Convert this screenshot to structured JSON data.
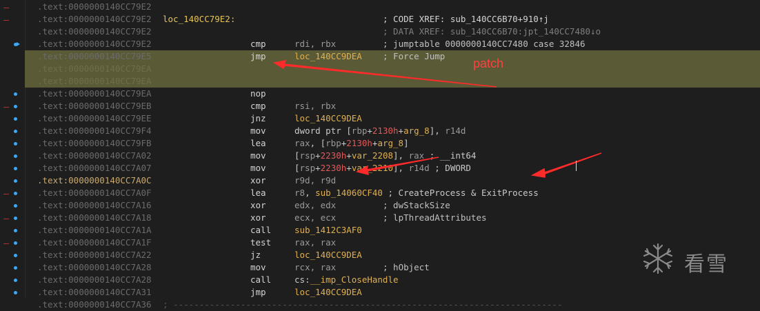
{
  "colors": {
    "background": "#1e1e1e",
    "highlight": "#5a5a36",
    "address": "#6b6b6b",
    "label": "#e4c45a",
    "annotation": "#ff4040"
  },
  "annotation_label": "patch",
  "watermark": "看雪",
  "lines": [
    {
      "addr": ".text:0000000140CC79E2"
    },
    {
      "addr": ".text:0000000140CC79E2",
      "label": "loc_140CC79E2:",
      "comment": "; CODE XREF: sub_140CC6B70+910↑j"
    },
    {
      "addr": ".text:0000000140CC79E2",
      "comment": "; DATA XREF: sub_140CC6B70:jpt_140CC7480↓o"
    },
    {
      "addr": ".text:0000000140CC79E2",
      "mn": "cmp",
      "ops": [
        [
          "reg",
          "rdi, rbx"
        ]
      ],
      "comment": "; jumptable 0000000140CC7480 case 32846"
    },
    {
      "addr": ".text:0000000140CC79E5",
      "mn": "jmp",
      "ops": [
        [
          "nm",
          "loc_140CC9DEA"
        ]
      ],
      "comment": "; Force Jump"
    },
    {
      "addr": ".text:0000000140CC79EA"
    },
    {
      "addr": ".text:0000000140CC79EA"
    },
    {
      "addr": ".text:0000000140CC79EA",
      "mn": "nop"
    },
    {
      "addr": ".text:0000000140CC79EB",
      "mn": "cmp",
      "ops": [
        [
          "reg",
          "rsi, rbx"
        ]
      ]
    },
    {
      "addr": ".text:0000000140CC79EE",
      "mn": "jnz",
      "ops": [
        [
          "nm",
          "loc_140CC9DEA"
        ]
      ]
    },
    {
      "addr": ".text:0000000140CC79F4",
      "mn": "mov",
      "ops": [
        [
          "tx",
          "dword ptr ["
        ],
        [
          "reg",
          "rbp"
        ],
        [
          "tx",
          "+"
        ],
        [
          "num",
          "2130h"
        ],
        [
          "tx",
          "+"
        ],
        [
          "nm",
          "arg_8"
        ],
        [
          "tx",
          "], "
        ],
        [
          "reg",
          "r14d"
        ]
      ]
    },
    {
      "addr": ".text:0000000140CC79FB",
      "mn": "lea",
      "ops": [
        [
          "reg",
          "rax"
        ],
        [
          "tx",
          ", ["
        ],
        [
          "reg",
          "rbp"
        ],
        [
          "tx",
          "+"
        ],
        [
          "num",
          "2130h"
        ],
        [
          "tx",
          "+"
        ],
        [
          "nm",
          "arg_8"
        ],
        [
          "tx",
          "]"
        ]
      ]
    },
    {
      "addr": ".text:0000000140CC7A02",
      "mn": "mov",
      "ops": [
        [
          "tx",
          "["
        ],
        [
          "reg",
          "rsp"
        ],
        [
          "tx",
          "+"
        ],
        [
          "num",
          "2230h"
        ],
        [
          "tx",
          "+"
        ],
        [
          "nm",
          "var_2208"
        ],
        [
          "tx",
          "], "
        ],
        [
          "reg",
          "rax"
        ],
        [
          "tx",
          " ; __int64"
        ]
      ]
    },
    {
      "addr": ".text:0000000140CC7A07",
      "mn": "mov",
      "ops": [
        [
          "tx",
          "["
        ],
        [
          "reg",
          "rsp"
        ],
        [
          "tx",
          "+"
        ],
        [
          "num",
          "2230h"
        ],
        [
          "tx",
          "+"
        ],
        [
          "nm",
          "var_2210"
        ],
        [
          "tx",
          "], "
        ],
        [
          "reg",
          "r14d"
        ],
        [
          "tx",
          " ; DWORD"
        ]
      ]
    },
    {
      "addr": ".text:0000000140CC7A0C",
      "mn": "xor",
      "ops": [
        [
          "reg",
          "r9d, r9d"
        ]
      ],
      "current": true
    },
    {
      "addr": ".text:0000000140CC7A0F",
      "mn": "lea",
      "ops": [
        [
          "reg",
          "r8"
        ],
        [
          "tx",
          ", "
        ],
        [
          "nm",
          "sub_14060CF40"
        ],
        [
          "tx",
          " ; CreateProcess & ExitProcess"
        ]
      ]
    },
    {
      "addr": ".text:0000000140CC7A16",
      "mn": "xor",
      "ops": [
        [
          "reg",
          "edx, edx"
        ]
      ],
      "comment": "; dwStackSize"
    },
    {
      "addr": ".text:0000000140CC7A18",
      "mn": "xor",
      "ops": [
        [
          "reg",
          "ecx, ecx"
        ]
      ],
      "comment": "; lpThreadAttributes"
    },
    {
      "addr": ".text:0000000140CC7A1A",
      "mn": "call",
      "ops": [
        [
          "nm",
          "sub_1412C3AF0"
        ]
      ]
    },
    {
      "addr": ".text:0000000140CC7A1F",
      "mn": "test",
      "ops": [
        [
          "reg",
          "rax, rax"
        ]
      ]
    },
    {
      "addr": ".text:0000000140CC7A22",
      "mn": "jz",
      "ops": [
        [
          "nm",
          "loc_140CC9DEA"
        ]
      ]
    },
    {
      "addr": ".text:0000000140CC7A28",
      "mn": "mov",
      "ops": [
        [
          "reg",
          "rcx, rax"
        ]
      ],
      "comment": "; hObject"
    },
    {
      "addr": ".text:0000000140CC7A28",
      "mn": "call",
      "ops": [
        [
          "tx",
          "cs:"
        ],
        [
          "nm",
          "__imp_CloseHandle"
        ]
      ]
    },
    {
      "addr": ".text:0000000140CC7A31",
      "mn": "jmp",
      "ops": [
        [
          "nm",
          "loc_140CC9DEA"
        ]
      ]
    },
    {
      "addr": ".text:0000000140CC7A36",
      "sep": "; ---------------------------------------------------------------------------"
    }
  ]
}
